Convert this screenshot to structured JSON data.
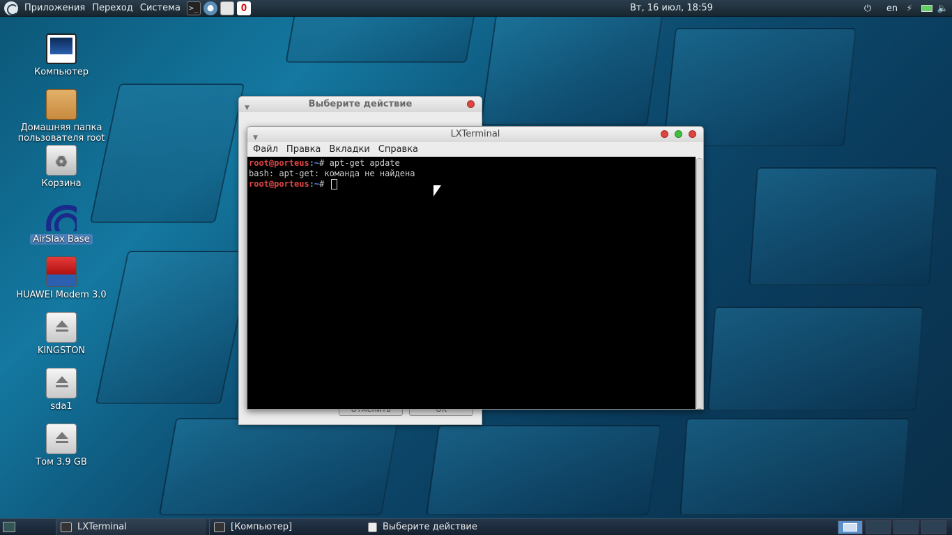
{
  "top_panel": {
    "menus": [
      "Приложения",
      "Переход",
      "Система"
    ],
    "launchers": [
      "terminal-icon",
      "browser-icon",
      "file-manager-icon",
      "opera-icon"
    ],
    "clock": "Вт, 16 июл, 18:59",
    "keyboard_layout": "en"
  },
  "desktop": {
    "icons": [
      {
        "label": "Компьютер",
        "icon": "computer-icon"
      },
      {
        "label": "Домашняя папка\nпользователя root",
        "icon": "home-folder-icon"
      },
      {
        "label": "Корзина",
        "icon": "trash-icon"
      },
      {
        "label": "AirSlax Base",
        "icon": "wifi-icon",
        "selected": true
      },
      {
        "label": "HUAWEI Modem 3.0",
        "icon": "huawei-icon"
      },
      {
        "label": "KINGSTON",
        "icon": "drive-icon"
      },
      {
        "label": "sda1",
        "icon": "drive-icon"
      },
      {
        "label": "Том 3.9 GB",
        "icon": "drive-icon"
      }
    ]
  },
  "dialog": {
    "title": "Выберите действие",
    "cancel_label": "Отменить",
    "ok_label": "OK"
  },
  "terminal": {
    "title": "LXTerminal",
    "menu": [
      "Файл",
      "Правка",
      "Вкладки",
      "Справка"
    ],
    "lines": [
      {
        "user": "root@porteus",
        "path": ":~",
        "symbol": "#",
        "cmd": " apt-get apdate"
      },
      {
        "output": "bash: apt-get: команда не найдена"
      },
      {
        "user": "root@porteus",
        "path": ":~",
        "symbol": "#",
        "cmd": " "
      }
    ]
  },
  "taskbar": {
    "items": [
      {
        "label": "LXTerminal",
        "icon": "terminal-icon"
      },
      {
        "label": "[Компьютер]",
        "icon": "computer-icon"
      },
      {
        "label": "Выберите действие",
        "icon": "dialog-icon"
      }
    ]
  },
  "colors": {
    "prompt_user": "#e04646",
    "prompt_path": "#5d8fe6",
    "close": "#e0443e",
    "maximize": "#3fbf3f",
    "minimize": "#e0a040"
  }
}
